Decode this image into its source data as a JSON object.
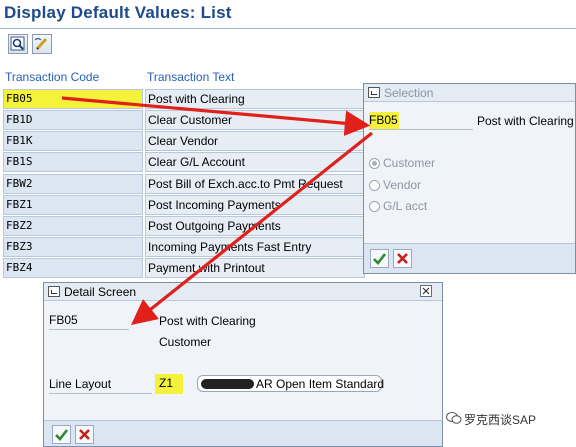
{
  "window": {
    "title": "Display Default Values: List"
  },
  "toolbar": {
    "buttons": [
      {
        "icon": "detail-magnifier-icon"
      },
      {
        "icon": "edit-pencil-icon"
      }
    ]
  },
  "table": {
    "headers": {
      "code": "Transaction Code",
      "text": "Transaction Text"
    },
    "rows": [
      {
        "code": "FB05",
        "text": "Post with Clearing"
      },
      {
        "code": "FB1D",
        "text": "Clear Customer"
      },
      {
        "code": "FB1K",
        "text": "Clear Vendor"
      },
      {
        "code": "FB1S",
        "text": "Clear G/L Account"
      },
      {
        "code": "FBW2",
        "text": "Post Bill of Exch.acc.to Pmt Request"
      },
      {
        "code": "FBZ1",
        "text": "Post Incoming Payments"
      },
      {
        "code": "FBZ2",
        "text": "Post Outgoing Payments"
      },
      {
        "code": "FBZ3",
        "text": "Incoming Payments Fast Entry"
      },
      {
        "code": "FBZ4",
        "text": "Payment with Printout"
      }
    ]
  },
  "selection_popup": {
    "title": "Selection",
    "code": "FB05",
    "text": "Post with Clearing",
    "options": [
      {
        "label": "Customer",
        "selected": true
      },
      {
        "label": "Vendor",
        "selected": false
      },
      {
        "label": "G/L acct",
        "selected": false
      }
    ]
  },
  "detail_popup": {
    "title": "Detail Screen",
    "code": "FB05",
    "text": "Post with Clearing",
    "account_type": "Customer",
    "line_layout_label": "Line Layout",
    "line_layout_value": "Z1",
    "line_layout_desc": "AR Open Item Standard"
  },
  "watermark": "罗克西谈SAP",
  "colors": {
    "highlight": "#f4f23a",
    "arrow": "#e0201b",
    "header_blue": "#1c4a8a",
    "link_blue": "#2561b8"
  }
}
